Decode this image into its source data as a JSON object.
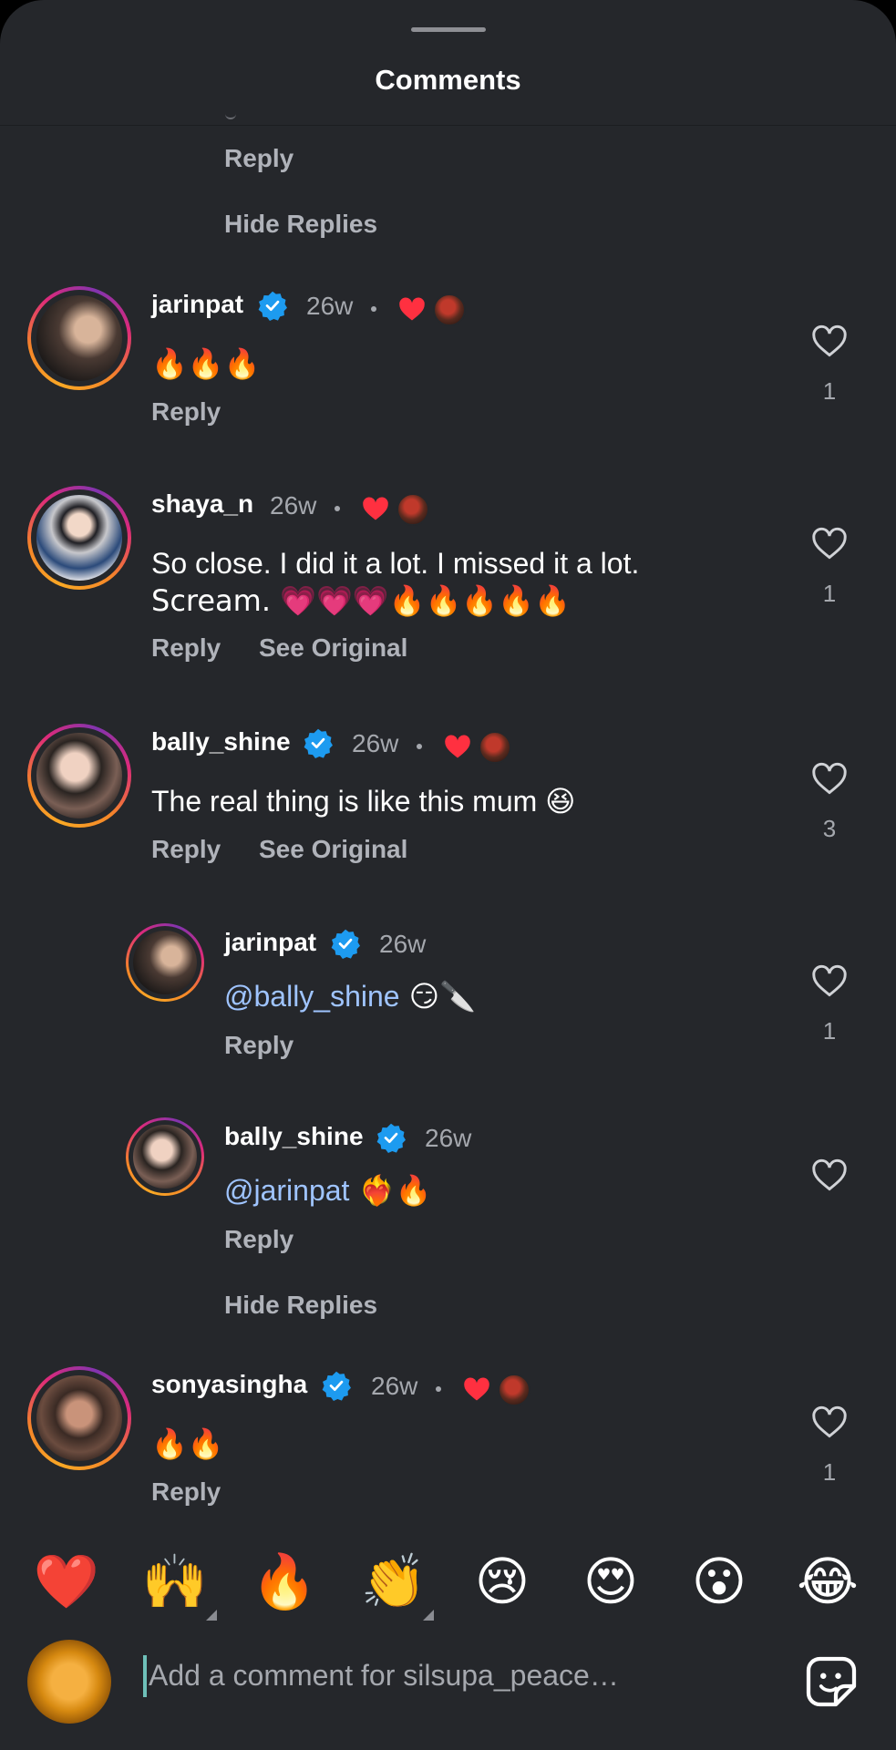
{
  "sheet": {
    "title": "Comments"
  },
  "top_thread": {
    "reply": "Reply",
    "hide_replies": "Hide Replies"
  },
  "comments": [
    {
      "username": "jarinpat",
      "verified": true,
      "time": "26w",
      "text": "🔥🔥🔥",
      "reply": "Reply",
      "likes": "1"
    },
    {
      "username": "shaya_n",
      "verified": false,
      "time": "26w",
      "text_line1": "So close. I did it a lot. I missed it a lot.",
      "text_line2": "Scream. 💗💗💗🔥🔥🔥🔥🔥",
      "reply": "Reply",
      "see_original": "See Original",
      "likes": "1"
    },
    {
      "username": "bally_shine",
      "verified": true,
      "time": "26w",
      "text": "The real thing is like this mum 😆",
      "reply": "Reply",
      "see_original": "See Original",
      "likes": "3",
      "replies": [
        {
          "username": "jarinpat",
          "verified": true,
          "time": "26w",
          "mention": "@bally_shine",
          "text": " 😏🔪",
          "reply": "Reply",
          "likes": "1"
        },
        {
          "username": "bally_shine",
          "verified": true,
          "time": "26w",
          "mention": "@jarinpat",
          "text": " ❤️‍🔥🔥",
          "reply": "Reply",
          "likes": ""
        }
      ],
      "hide_replies": "Hide Replies"
    },
    {
      "username": "sonyasingha",
      "verified": true,
      "time": "26w",
      "text": "🔥🔥",
      "reply": "Reply",
      "likes": "1"
    }
  ],
  "reactions": [
    "❤️",
    "🙌",
    "🔥",
    "👏",
    "😢",
    "😍",
    "😮",
    "😂"
  ],
  "composer": {
    "placeholder": "Add a comment for silsupa_peace…",
    "sticker_icon": "sticker-icon"
  },
  "colors": {
    "background": "#25272b",
    "verified": "#1d9bf0",
    "liked": "#ff3040",
    "mention": "#9fc4ff"
  }
}
